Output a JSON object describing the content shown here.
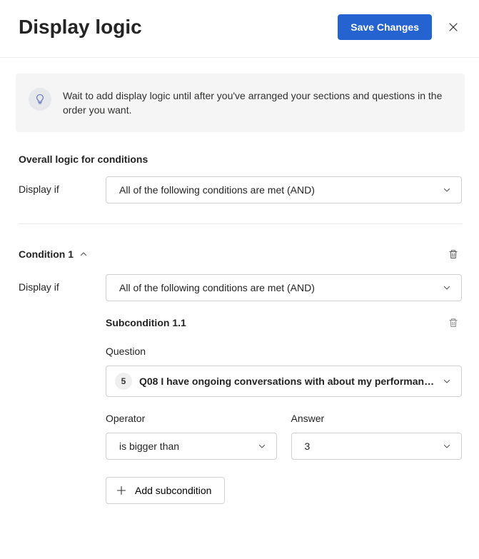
{
  "header": {
    "title": "Display logic",
    "saveLabel": "Save Changes"
  },
  "info": {
    "text": "Wait to add display logic until after you've arranged your sections and questions in the order you want."
  },
  "overall": {
    "title": "Overall logic for conditions",
    "displayIfLabel": "Display if",
    "displayIfValue": "All of the following conditions are met (AND)"
  },
  "condition": {
    "title": "Condition 1",
    "displayIfLabel": "Display if",
    "displayIfValue": "All of the following conditions are met (AND)",
    "subcondition": {
      "title": "Subcondition 1.1",
      "questionLabel": "Question",
      "questionBadge": "5",
      "questionText": "Q08 I have ongoing conversations with about my performan…",
      "operatorLabel": "Operator",
      "operatorValue": "is bigger than",
      "answerLabel": "Answer",
      "answerValue": "3"
    },
    "addSubLabel": "Add subcondition"
  }
}
